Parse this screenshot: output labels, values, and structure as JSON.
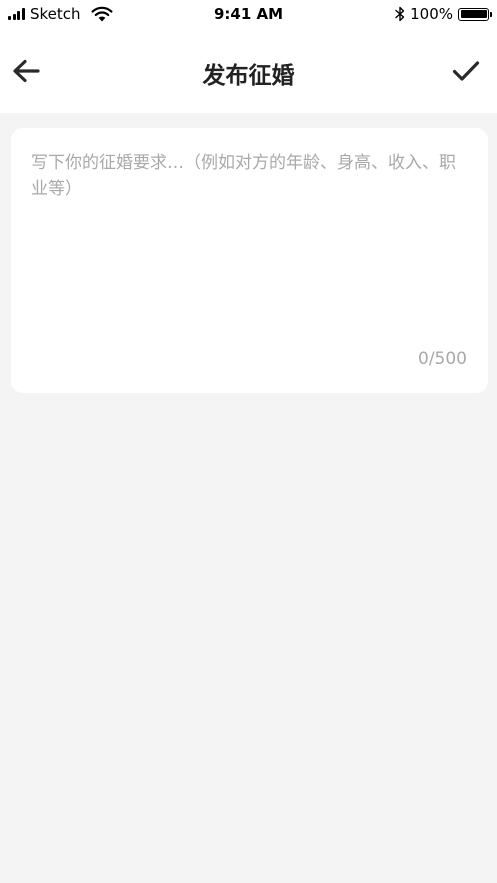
{
  "status_bar": {
    "carrier": "Sketch",
    "time": "9:41 AM",
    "battery_pct": "100%",
    "icons": [
      "signal-icon",
      "wifi-icon",
      "bluetooth-icon",
      "battery-icon"
    ],
    "battery_level": 1.0
  },
  "nav": {
    "title": "发布征婚",
    "back_icon": "arrow-left-icon",
    "confirm_icon": "checkmark-icon"
  },
  "form": {
    "value": "",
    "placeholder": "写下你的征婚要求…（例如对方的年龄、身高、收入、职业等）",
    "counter": "0/500"
  },
  "colors": {
    "page_background": "#f4f4f4",
    "card_background": "#ffffff",
    "title_text": "#222222",
    "placeholder_text": "#a9a9a9"
  }
}
